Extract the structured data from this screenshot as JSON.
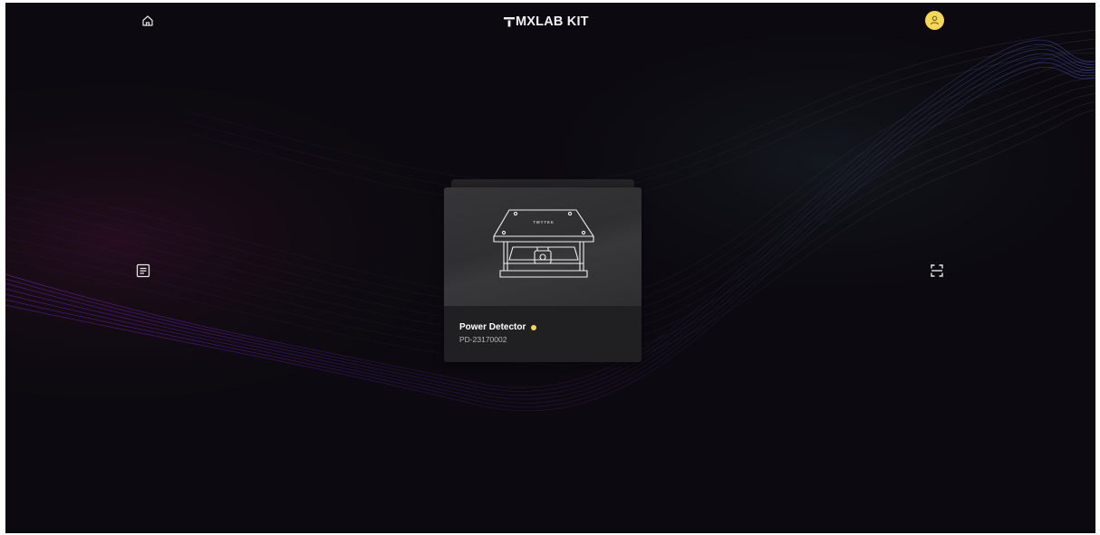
{
  "app": {
    "brand_title": "MXLAB KIT",
    "accent_color": "#f4d65a",
    "background_color": "#0c0a10"
  },
  "topbar": {
    "home_icon": "home-icon",
    "avatar_icon": "user-avatar-icon"
  },
  "sidebar_left": {
    "icon": "document-list-icon"
  },
  "sidebar_right": {
    "icon": "scan-icon"
  },
  "device_card": {
    "name": "Power Detector",
    "serial": "PD-23170002",
    "status_color": "#f4d65a",
    "image_label": "TMYTEK"
  }
}
